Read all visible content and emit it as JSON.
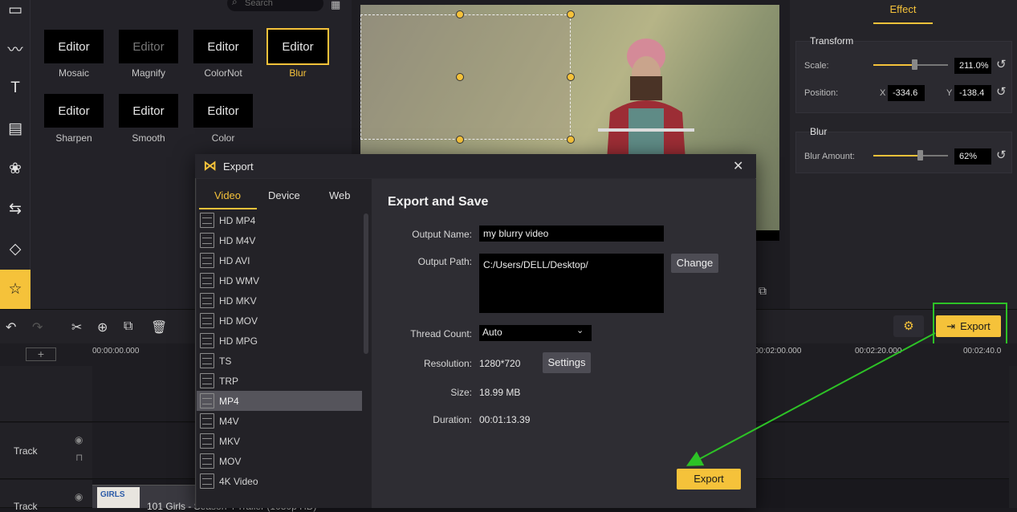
{
  "library": {
    "search_placeholder": "Search",
    "tiles": [
      {
        "thumb": "Editor",
        "label": "Mosaic"
      },
      {
        "thumb": "Editor",
        "label": "Magnify"
      },
      {
        "thumb": "Editor",
        "label": "ColorNot"
      },
      {
        "thumb": "Editor",
        "label": "Blur"
      },
      {
        "thumb": "Editor",
        "label": "Sharpen"
      },
      {
        "thumb": "Editor",
        "label": "Smooth"
      },
      {
        "thumb": "Editor",
        "label": "Color"
      }
    ]
  },
  "props": {
    "tab": "Effect",
    "transform": {
      "title": "Transform",
      "scale_label": "Scale:",
      "scale_value": "211.0%",
      "scale_level": 0.55,
      "position_label": "Position:",
      "x_label": "X",
      "x_value": "-334.6",
      "y_label": "Y",
      "y_value": "-138.4"
    },
    "blur": {
      "title": "Blur",
      "amount_label": "Blur Amount:",
      "amount_value": "62%",
      "amount_level": 0.62
    }
  },
  "timeline": {
    "times": [
      "00:00:00.000",
      "00:02:00.000",
      "00:02:20.000",
      "00:02:40.0"
    ],
    "track_label": "Track",
    "export_label": "Export",
    "clip_title": "101 Girls - Season 4 Trailer (1080p HD)",
    "clip_thumb": "GIRLS"
  },
  "dialog": {
    "title": "Export",
    "tabs": [
      "Video",
      "Device",
      "Web"
    ],
    "formats": [
      "HD MP4",
      "HD M4V",
      "HD AVI",
      "HD WMV",
      "HD MKV",
      "HD MOV",
      "HD MPG",
      "TS",
      "TRP",
      "MP4",
      "M4V",
      "MKV",
      "MOV",
      "4K Video"
    ],
    "form_title": "Export and Save",
    "output_name_label": "Output Name:",
    "output_name": "my blurry video",
    "output_path_label": "Output Path:",
    "output_path": "C:/Users/DELL/Desktop/",
    "change_label": "Change",
    "thread_label": "Thread Count:",
    "thread_value": "Auto",
    "resolution_label": "Resolution:",
    "resolution_value": "1280*720",
    "settings_label": "Settings",
    "size_label": "Size:",
    "size_value": "18.99 MB",
    "duration_label": "Duration:",
    "duration_value": "00:01:13.39",
    "export_label": "Export"
  },
  "colors": {
    "accent": "#f5c23a",
    "annotation": "#2dc226"
  }
}
